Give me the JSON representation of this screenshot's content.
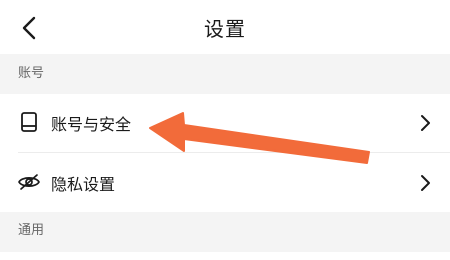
{
  "nav": {
    "title": "设置",
    "back_icon": "chevron-left-icon"
  },
  "sections": {
    "account_header": "账号",
    "general_header": "通用"
  },
  "rows": {
    "security": {
      "label": "账号与安全",
      "icon": "phone-icon"
    },
    "privacy": {
      "label": "隐私设置",
      "icon": "eye-slash-icon"
    }
  },
  "annotation": {
    "arrow_color": "#f26b3a"
  }
}
